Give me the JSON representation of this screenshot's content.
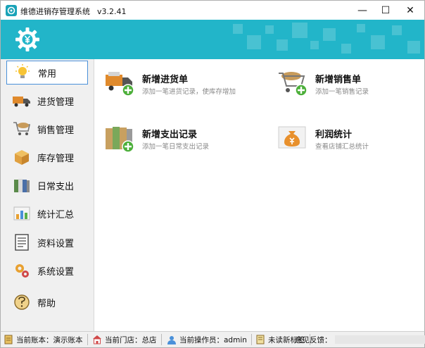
{
  "window": {
    "title": "维德进销存管理系统",
    "version": "v3.2.41",
    "minimize_glyph": "—",
    "maximize_glyph": "☐",
    "close_glyph": "✕"
  },
  "colors": {
    "banner": "#22b5c9",
    "active_border": "#4a90d9",
    "sidebar_bg": "#f0f0f0"
  },
  "sidebar": {
    "items": [
      {
        "label": "常用",
        "icon": "lightbulb-icon",
        "active": true
      },
      {
        "label": "进货管理",
        "icon": "truck-icon",
        "active": false
      },
      {
        "label": "销售管理",
        "icon": "shopping-cart-icon",
        "active": false
      },
      {
        "label": "库存管理",
        "icon": "box-icon",
        "active": false
      },
      {
        "label": "日常支出",
        "icon": "binders-icon",
        "active": false
      },
      {
        "label": "统计汇总",
        "icon": "bar-chart-icon",
        "active": false
      },
      {
        "label": "资料设置",
        "icon": "document-icon",
        "active": false
      },
      {
        "label": "系统设置",
        "icon": "gears-icon",
        "active": false
      },
      {
        "label": "帮助",
        "icon": "help-icon",
        "active": false
      }
    ]
  },
  "main": {
    "tiles": [
      {
        "title": "新增进货单",
        "desc": "添加一笔进货记录，使库存增加",
        "icon": "truck-add-icon"
      },
      {
        "title": "新增销售单",
        "desc": "添加一笔销售记录",
        "icon": "cart-add-icon"
      },
      {
        "title": "新增支出记录",
        "desc": "添加一笔日常支出记录",
        "icon": "binders-add-icon"
      },
      {
        "title": "利润统计",
        "desc": "查看店铺汇总统计",
        "icon": "money-bag-icon"
      }
    ]
  },
  "statusbar": {
    "account": "当前账本：演示账本",
    "store": "当前门店：总店",
    "operator": "当前操作员：admin",
    "unread": "未读新标签",
    "feedback_label": "意见反馈："
  }
}
